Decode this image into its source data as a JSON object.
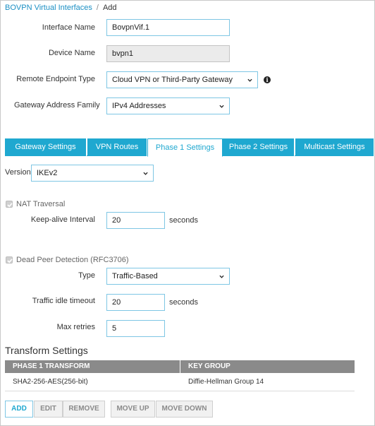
{
  "breadcrumb": {
    "parent": "BOVPN Virtual Interfaces",
    "separator": "/",
    "current": "Add"
  },
  "form": {
    "interface_name": {
      "label": "Interface Name",
      "value": "BovpnVif.1"
    },
    "device_name": {
      "label": "Device Name",
      "value": "bvpn1"
    },
    "remote_endpoint_type": {
      "label": "Remote Endpoint Type",
      "value": "Cloud VPN or Third-Party Gateway"
    },
    "gateway_address_family": {
      "label": "Gateway Address Family",
      "value": "IPv4 Addresses"
    }
  },
  "tabs": [
    {
      "label": "Gateway Settings",
      "active": false
    },
    {
      "label": "VPN Routes",
      "active": false
    },
    {
      "label": "Phase 1 Settings",
      "active": true
    },
    {
      "label": "Phase 2 Settings",
      "active": false
    },
    {
      "label": "Multicast Settings",
      "active": false
    }
  ],
  "phase1": {
    "version": {
      "label": "Version",
      "value": "IKEv2"
    },
    "nat_traversal": {
      "label": "NAT Traversal",
      "checked": true,
      "disabled": true
    },
    "keepalive": {
      "label": "Keep-alive Interval",
      "value": "20",
      "unit": "seconds"
    },
    "dpd": {
      "label": "Dead Peer Detection (RFC3706)",
      "checked": true,
      "disabled": true
    },
    "type": {
      "label": "Type",
      "value": "Traffic-Based"
    },
    "idle_timeout": {
      "label": "Traffic idle timeout",
      "value": "20",
      "unit": "seconds"
    },
    "max_retries": {
      "label": "Max retries",
      "value": "5"
    }
  },
  "transform": {
    "title": "Transform Settings",
    "columns": [
      "PHASE 1 TRANSFORM",
      "KEY GROUP"
    ],
    "rows": [
      [
        "SHA2-256-AES(256-bit)",
        "Diffie-Hellman Group 14"
      ]
    ]
  },
  "buttons": {
    "add": "ADD",
    "edit": "EDIT",
    "remove": "REMOVE",
    "move_up": "MOVE UP",
    "move_down": "MOVE DOWN"
  },
  "colors": {
    "accent": "#1fa8d0",
    "link": "#1b8fc4",
    "table_header": "#8a8a8a"
  },
  "icons": {
    "info": "info-icon",
    "dropdown": "chevron-down-icon",
    "checkbox": "checkmark-icon"
  }
}
